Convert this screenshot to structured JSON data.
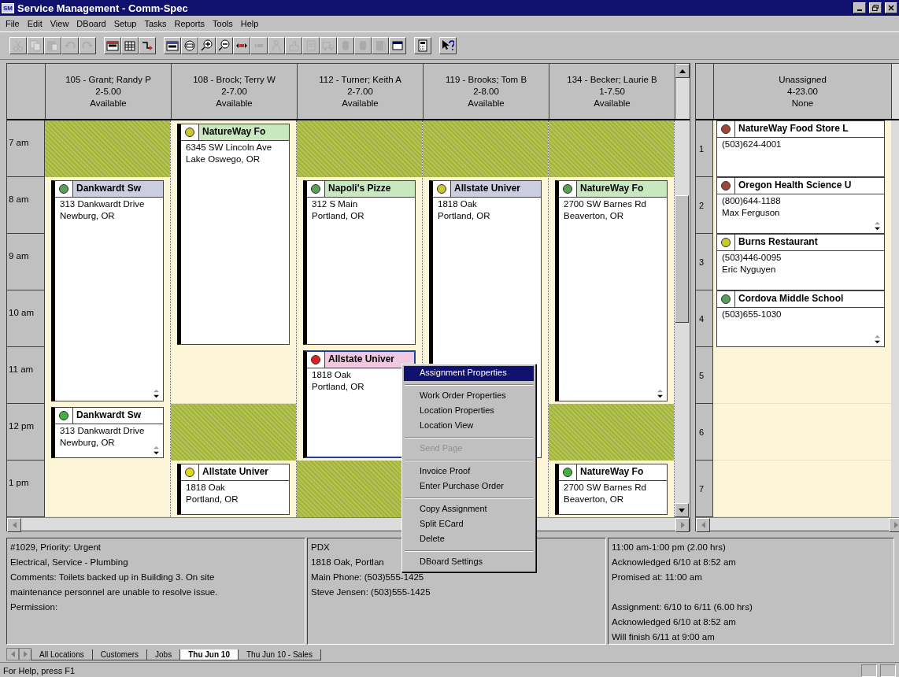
{
  "window": {
    "icon_text": "SM",
    "title": "Service Management - Comm-Spec"
  },
  "menu_bar": [
    "File",
    "Edit",
    "View",
    "DBoard",
    "Setup",
    "Tasks",
    "Reports",
    "Tools",
    "Help"
  ],
  "toolbar": {
    "groups": [
      [
        {
          "disabled": true
        },
        {
          "disabled": true
        },
        {
          "disabled": true
        },
        {
          "disabled": true
        },
        {
          "disabled": true
        }
      ],
      [
        {
          "disabled": false
        },
        {
          "disabled": false
        },
        {
          "disabled": false
        }
      ],
      [
        {
          "disabled": false
        },
        {
          "disabled": false
        },
        {
          "disabled": false
        },
        {
          "disabled": false
        },
        {
          "disabled": false
        },
        {
          "disabled": true
        },
        {
          "disabled": true
        },
        {
          "disabled": true
        },
        {
          "disabled": true
        },
        {
          "disabled": true
        },
        {
          "disabled": true
        },
        {
          "disabled": true
        },
        {
          "disabled": true
        },
        {
          "disabled": false
        }
      ],
      [
        {
          "disabled": false
        }
      ],
      [
        {
          "disabled": false
        }
      ]
    ]
  },
  "time_slots": [
    "7 am",
    "8 am",
    "9 am",
    "10 am",
    "11 am",
    "12 pm",
    "1 pm"
  ],
  "technicians": [
    {
      "name": "105 - Grant; Randy P",
      "hours": "2-5.00",
      "status": "Available",
      "slots": [
        {
          "kind": "blocked"
        },
        {
          "kind": "card",
          "color": "#58a058",
          "header": {
            "color": "#cdcde2"
          },
          "title": "Dankwardt Sw",
          "lines": [
            "313 Dankwardt Drive",
            "Newburg, OR"
          ],
          "selected": false,
          "overflow": true
        },
        {
          "kind": "continued"
        },
        {
          "kind": "continued"
        },
        {
          "kind": "continued"
        },
        {
          "kind": "card",
          "color": "#40b040",
          "header": {
            "color": "#ffffff"
          },
          "title": "Dankwardt Sw",
          "lines": [
            "313 Dankwardt Drive",
            "Newburg, OR"
          ],
          "selected": false,
          "overflow": true
        },
        {
          "kind": "free"
        }
      ]
    },
    {
      "name": "108 - Brock; Terry W",
      "hours": "2-7.00",
      "status": "Available",
      "slots": [
        {
          "kind": "card",
          "color": "#c8c830",
          "header": {
            "color": "#c8e8c0"
          },
          "title": "NatureWay Fo",
          "lines": [
            "6345 SW Lincoln Ave",
            "Lake Oswego, OR"
          ],
          "selected": false,
          "overflow": false
        },
        {
          "kind": "continued"
        },
        {
          "kind": "continued"
        },
        {
          "kind": "continued"
        },
        {
          "kind": "free"
        },
        {
          "kind": "blocked"
        },
        {
          "kind": "card",
          "color": "#e0d820",
          "header": {
            "color": "#ffffff"
          },
          "title": "Allstate Univer",
          "lines": [
            "1818 Oak",
            "Portland, OR"
          ],
          "selected": false,
          "overflow": false
        }
      ]
    },
    {
      "name": "112 - Turner; Keith A",
      "hours": "2-7.00",
      "status": "Available",
      "slots": [
        {
          "kind": "blocked"
        },
        {
          "kind": "card",
          "color": "#58a058",
          "header": {
            "color": "#c8e8c0"
          },
          "title": "Napoli's Pizze",
          "lines": [
            "312 S Main",
            "Portland, OR"
          ],
          "selected": false,
          "overflow": false
        },
        {
          "kind": "continued"
        },
        {
          "kind": "continued"
        },
        {
          "kind": "card",
          "color": "#e02020",
          "header": {
            "color": "#f0c8e0"
          },
          "title": "Allstate Univer",
          "lines": [
            "1818 Oak",
            "Portland, OR"
          ],
          "selected": true,
          "overflow": false
        },
        {
          "kind": "continued"
        },
        {
          "kind": "blocked"
        }
      ]
    },
    {
      "name": "119 - Brooks; Tom B",
      "hours": "2-8.00",
      "status": "Available",
      "slots": [
        {
          "kind": "blocked"
        },
        {
          "kind": "card",
          "color": "#c8c830",
          "header": {
            "color": "#cdcde2"
          },
          "title": "Allstate Univer",
          "lines": [
            "1818 Oak",
            "Portland, OR"
          ],
          "selected": false
        },
        {
          "kind": "continued"
        },
        {
          "kind": "continued"
        },
        {
          "kind": "continued"
        },
        {
          "kind": "continued"
        },
        {
          "kind": "free"
        }
      ]
    },
    {
      "name": "134 - Becker; Laurie B",
      "hours": "1-7.50",
      "status": "Available",
      "slots": [
        {
          "kind": "blocked"
        },
        {
          "kind": "card",
          "color": "#58a058",
          "header": {
            "color": "#c8e8c0"
          },
          "title": "NatureWay Fo",
          "lines": [
            "2700 SW Barnes Rd",
            "Beaverton, OR"
          ],
          "selected": false,
          "overflow": true
        },
        {
          "kind": "continued"
        },
        {
          "kind": "continued"
        },
        {
          "kind": "continued"
        },
        {
          "kind": "blocked"
        },
        {
          "kind": "card",
          "color": "#40b040",
          "header": {
            "color": "#ffffff"
          },
          "title": "NatureWay Fo",
          "lines": [
            "2700 SW Barnes Rd",
            "Beaverton, OR"
          ],
          "selected": false,
          "overflow": false
        }
      ]
    }
  ],
  "unassigned": {
    "name": "Unassigned",
    "hours": "4-23.00",
    "status": "None",
    "rows": [
      {
        "number": "1",
        "card": {
          "color": "#a04838",
          "title": "NatureWay Food Store L",
          "lines": [
            "(503)624-4001"
          ],
          "overflow": false
        }
      },
      {
        "number": "2",
        "card": {
          "color": "#a04838",
          "title": "Oregon Health Science U",
          "lines": [
            "(800)644-1188",
            "Max Ferguson"
          ],
          "overflow": true
        }
      },
      {
        "number": "3",
        "card": {
          "color": "#c8c830",
          "title": "Burns Restaurant",
          "lines": [
            "(503)446-0095",
            "Eric Nyguyen"
          ],
          "overflow": false
        }
      },
      {
        "number": "4",
        "card": {
          "color": "#58a058",
          "title": "Cordova Middle School",
          "lines": [
            "(503)655-1030"
          ],
          "overflow": true
        }
      },
      {
        "number": "5"
      },
      {
        "number": "6"
      },
      {
        "number": "7"
      }
    ]
  },
  "context_menu": [
    {
      "kind": "item",
      "label": "Assignment Properties",
      "selected": true,
      "disabled": false
    },
    {
      "kind": "separator"
    },
    {
      "kind": "item",
      "label": "Work Order Properties",
      "selected": false,
      "disabled": false
    },
    {
      "kind": "item",
      "label": "Location Properties",
      "selected": false,
      "disabled": false
    },
    {
      "kind": "item",
      "label": "Location View",
      "selected": false,
      "disabled": false
    },
    {
      "kind": "separator"
    },
    {
      "kind": "item",
      "label": "Send Page",
      "selected": false,
      "disabled": true
    },
    {
      "kind": "separator"
    },
    {
      "kind": "item",
      "label": "Invoice Proof",
      "selected": false,
      "disabled": false
    },
    {
      "kind": "item",
      "label": "Enter Purchase Order",
      "selected": false,
      "disabled": false
    },
    {
      "kind": "separator"
    },
    {
      "kind": "item",
      "label": "Copy Assignment",
      "selected": false,
      "disabled": false
    },
    {
      "kind": "item",
      "label": "Split ECard",
      "selected": false,
      "disabled": false
    },
    {
      "kind": "item",
      "label": "Delete",
      "selected": false,
      "disabled": false
    },
    {
      "kind": "separator"
    },
    {
      "kind": "item",
      "label": "DBoard Settings",
      "selected": false,
      "disabled": false
    }
  ],
  "details": [
    {
      "paragraphs": [
        [
          "#1029, Priority: Urgent",
          "Electrical, Service - Plumbing",
          "Comments: Toilets backed up in Building 3.  On site",
          "maintenance personnel are unable to resolve issue.",
          "Permission:"
        ]
      ]
    },
    {
      "paragraphs": [
        [
          "PDX",
          "1818 Oak, Portlan",
          "Main Phone: (503)555-1425",
          "Steve Jensen: (503)555-1425"
        ]
      ]
    },
    {
      "paragraphs": [
        [
          "11:00 am-1:00 pm (2.00 hrs)",
          "Acknowledged 6/10 at 8:52 am",
          "Promised at: 11:00 am"
        ],
        [
          "Assignment: 6/10 to 6/11 (6.00 hrs)",
          "Acknowledged 6/10 at 8:52 am",
          "Will finish 6/11 at 9:00 am"
        ]
      ]
    }
  ],
  "sheet_tabs": [
    {
      "label": "All Locations",
      "selected": false
    },
    {
      "label": "Customers",
      "selected": false
    },
    {
      "label": "Jobs",
      "selected": false
    },
    {
      "label": "Thu Jun 10",
      "selected": true
    },
    {
      "label": "Thu Jun 10 - Sales",
      "selected": false
    }
  ],
  "status_bar": {
    "text": "For Help, press F1"
  }
}
